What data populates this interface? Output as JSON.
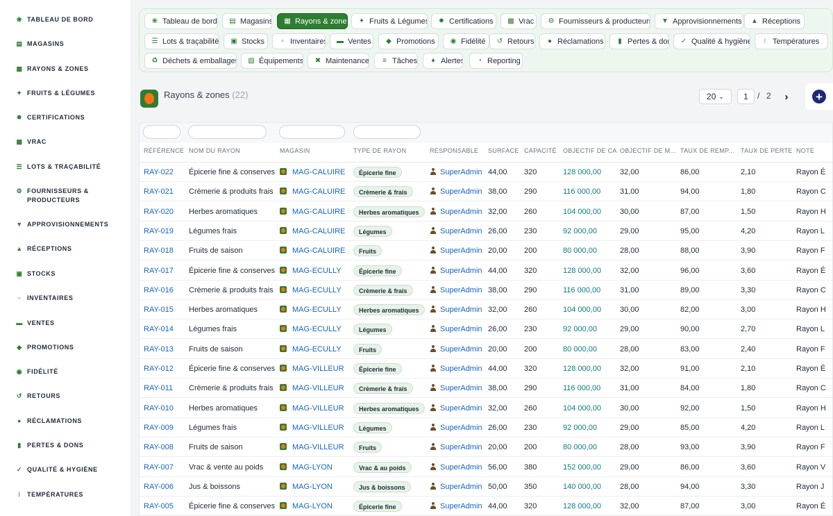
{
  "sidebar": {
    "items": [
      {
        "label": "TABLEAU DE BORD",
        "icon": "seedling-icon"
      },
      {
        "label": "MAGASINS",
        "icon": "store-icon"
      },
      {
        "label": "RAYONS & ZONES",
        "icon": "grid-icon"
      },
      {
        "label": "FRUITS & LÉGUMES",
        "icon": "carrot-icon"
      },
      {
        "label": "CERTIFICATIONS",
        "icon": "certificate-icon"
      },
      {
        "label": "VRAC",
        "icon": "boxes-icon"
      },
      {
        "label": "LOTS & TRAÇABILITÉ",
        "icon": "barcode-icon"
      },
      {
        "label": "FOURNISSEURS & PRODUCTEURS",
        "icon": "tractor-icon"
      },
      {
        "label": "APPROVISIONNEMENTS",
        "icon": "cart-icon"
      },
      {
        "label": "RÉCEPTIONS",
        "icon": "truck-icon"
      },
      {
        "label": "STOCKS",
        "icon": "warehouse-icon"
      },
      {
        "label": "INVENTAIRES",
        "icon": "clipboard-icon"
      },
      {
        "label": "VENTES",
        "icon": "cash-register-icon"
      },
      {
        "label": "PROMOTIONS",
        "icon": "tag-icon"
      },
      {
        "label": "FIDÉLITÉ",
        "icon": "award-icon"
      },
      {
        "label": "RETOURS",
        "icon": "undo-icon"
      },
      {
        "label": "RÉCLAMATIONS",
        "icon": "comment-icon"
      },
      {
        "label": "PERTES & DONS",
        "icon": "trash-icon"
      },
      {
        "label": "QUALITÉ & HYGIÈNE",
        "icon": "clipboard-check-icon"
      },
      {
        "label": "TEMPÉRATURES",
        "icon": "thermometer-icon"
      }
    ]
  },
  "nav": {
    "pills": [
      {
        "label": "Tableau de bord",
        "icon": "seedling-icon"
      },
      {
        "label": "Magasins",
        "icon": "store-icon"
      },
      {
        "label": "Rayons & zones",
        "icon": "grid-icon",
        "active": true
      },
      {
        "label": "Fruits & Légumes",
        "icon": "carrot-icon"
      },
      {
        "label": "Certifications",
        "icon": "certificate-icon"
      },
      {
        "label": "Vrac",
        "icon": "boxes-icon"
      },
      {
        "label": "Fournisseurs & producteurs",
        "icon": "tractor-icon"
      },
      {
        "label": "Approvisionnements",
        "icon": "cart-icon"
      },
      {
        "label": "Réceptions",
        "icon": "truck-icon"
      },
      {
        "label": "Lots & traçabilité",
        "icon": "barcode-icon"
      },
      {
        "label": "Stocks",
        "icon": "warehouse-icon"
      },
      {
        "label": "Inventaires",
        "icon": "clipboard-icon"
      },
      {
        "label": "Ventes",
        "icon": "cash-register-icon"
      },
      {
        "label": "Promotions",
        "icon": "tag-icon"
      },
      {
        "label": "Fidélité",
        "icon": "award-icon"
      },
      {
        "label": "Retours",
        "icon": "undo-icon"
      },
      {
        "label": "Réclamations",
        "icon": "comment-icon"
      },
      {
        "label": "Pertes & dons",
        "icon": "trash-icon"
      },
      {
        "label": "Qualité & hygiène",
        "icon": "clipboard-check-icon"
      },
      {
        "label": "Températures",
        "icon": "thermometer-icon"
      },
      {
        "label": "Déchets & emballages",
        "icon": "recycle-icon"
      },
      {
        "label": "Équipements",
        "icon": "toolbox-icon"
      },
      {
        "label": "Maintenance",
        "icon": "tools-icon"
      },
      {
        "label": "Tâches",
        "icon": "tasks-icon"
      },
      {
        "label": "Alertes",
        "icon": "bell-icon"
      },
      {
        "label": "Reporting",
        "icon": "chart-pie-icon"
      }
    ]
  },
  "page": {
    "title": "Rayons & zones",
    "count": "(22)"
  },
  "pagination": {
    "per_page": "20",
    "current": "1",
    "separator": "/",
    "total": "2"
  },
  "table": {
    "columns": [
      "RÉFÉRENCE",
      "NOM DU RAYON",
      "MAGASIN",
      "TYPE DE RAYON",
      "RESPONSABLE",
      "SURFACE",
      "CAPACITÉ",
      "OBJECTIF DE CA",
      "OBJECTIF DE M...",
      "TAUX DE REMP...",
      "TAUX DE PERTE",
      "NOTE"
    ],
    "rows": [
      {
        "ref": "RAY-022",
        "name": "Épicerie fine & conserves",
        "store": "MAG-CALUIRE",
        "type": "Épicerie fine",
        "resp": "SuperAdmin",
        "surface": "44,00",
        "capacity": "320",
        "ca": "128 000,00",
        "margin": "32,00",
        "fill": "86,00",
        "loss": "2,10",
        "note": "Rayon É"
      },
      {
        "ref": "RAY-021",
        "name": "Crèmerie & produits frais",
        "store": "MAG-CALUIRE",
        "type": "Crèmerie & frais",
        "resp": "SuperAdmin",
        "surface": "38,00",
        "capacity": "290",
        "ca": "116 000,00",
        "margin": "31,00",
        "fill": "94,00",
        "loss": "1,80",
        "note": "Rayon C"
      },
      {
        "ref": "RAY-020",
        "name": "Herbes aromatiques",
        "store": "MAG-CALUIRE",
        "type": "Herbes aromatiques",
        "resp": "SuperAdmin",
        "surface": "32,00",
        "capacity": "260",
        "ca": "104 000,00",
        "margin": "30,00",
        "fill": "87,00",
        "loss": "1,50",
        "note": "Rayon H"
      },
      {
        "ref": "RAY-019",
        "name": "Légumes frais",
        "store": "MAG-CALUIRE",
        "type": "Légumes",
        "resp": "SuperAdmin",
        "surface": "26,00",
        "capacity": "230",
        "ca": "92 000,00",
        "margin": "29,00",
        "fill": "95,00",
        "loss": "4,20",
        "note": "Rayon L"
      },
      {
        "ref": "RAY-018",
        "name": "Fruits de saison",
        "store": "MAG-CALUIRE",
        "type": "Fruits",
        "resp": "SuperAdmin",
        "surface": "20,00",
        "capacity": "200",
        "ca": "80 000,00",
        "margin": "28,00",
        "fill": "88,00",
        "loss": "3,90",
        "note": "Rayon F"
      },
      {
        "ref": "RAY-017",
        "name": "Épicerie fine & conserves",
        "store": "MAG-ECULLY",
        "type": "Épicerie fine",
        "resp": "SuperAdmin",
        "surface": "44,00",
        "capacity": "320",
        "ca": "128 000,00",
        "margin": "32,00",
        "fill": "96,00",
        "loss": "3,60",
        "note": "Rayon É"
      },
      {
        "ref": "RAY-016",
        "name": "Crèmerie & produits frais",
        "store": "MAG-ECULLY",
        "type": "Crèmerie & frais",
        "resp": "SuperAdmin",
        "surface": "38,00",
        "capacity": "290",
        "ca": "116 000,00",
        "margin": "31,00",
        "fill": "89,00",
        "loss": "3,30",
        "note": "Rayon C"
      },
      {
        "ref": "RAY-015",
        "name": "Herbes aromatiques",
        "store": "MAG-ECULLY",
        "type": "Herbes aromatiques",
        "resp": "SuperAdmin",
        "surface": "32,00",
        "capacity": "260",
        "ca": "104 000,00",
        "margin": "30,00",
        "fill": "82,00",
        "loss": "3,00",
        "note": "Rayon H"
      },
      {
        "ref": "RAY-014",
        "name": "Légumes frais",
        "store": "MAG-ECULLY",
        "type": "Légumes",
        "resp": "SuperAdmin",
        "surface": "26,00",
        "capacity": "230",
        "ca": "92 000,00",
        "margin": "29,00",
        "fill": "90,00",
        "loss": "2,70",
        "note": "Rayon L"
      },
      {
        "ref": "RAY-013",
        "name": "Fruits de saison",
        "store": "MAG-ECULLY",
        "type": "Fruits",
        "resp": "SuperAdmin",
        "surface": "20,00",
        "capacity": "200",
        "ca": "80 000,00",
        "margin": "28,00",
        "fill": "83,00",
        "loss": "2,40",
        "note": "Rayon F"
      },
      {
        "ref": "RAY-012",
        "name": "Épicerie fine & conserves",
        "store": "MAG-VILLEUR",
        "type": "Épicerie fine",
        "resp": "SuperAdmin",
        "surface": "44,00",
        "capacity": "320",
        "ca": "128 000,00",
        "margin": "32,00",
        "fill": "91,00",
        "loss": "2,10",
        "note": "Rayon É"
      },
      {
        "ref": "RAY-011",
        "name": "Crèmerie & produits frais",
        "store": "MAG-VILLEUR",
        "type": "Crèmerie & frais",
        "resp": "SuperAdmin",
        "surface": "38,00",
        "capacity": "290",
        "ca": "116 000,00",
        "margin": "31,00",
        "fill": "84,00",
        "loss": "1,80",
        "note": "Rayon C"
      },
      {
        "ref": "RAY-010",
        "name": "Herbes aromatiques",
        "store": "MAG-VILLEUR",
        "type": "Herbes aromatiques",
        "resp": "SuperAdmin",
        "surface": "32,00",
        "capacity": "260",
        "ca": "104 000,00",
        "margin": "30,00",
        "fill": "92,00",
        "loss": "1,50",
        "note": "Rayon H"
      },
      {
        "ref": "RAY-009",
        "name": "Légumes frais",
        "store": "MAG-VILLEUR",
        "type": "Légumes",
        "resp": "SuperAdmin",
        "surface": "26,00",
        "capacity": "230",
        "ca": "92 000,00",
        "margin": "29,00",
        "fill": "85,00",
        "loss": "4,20",
        "note": "Rayon L"
      },
      {
        "ref": "RAY-008",
        "name": "Fruits de saison",
        "store": "MAG-VILLEUR",
        "type": "Fruits",
        "resp": "SuperAdmin",
        "surface": "20,00",
        "capacity": "200",
        "ca": "80 000,00",
        "margin": "28,00",
        "fill": "93,00",
        "loss": "3,90",
        "note": "Rayon F"
      },
      {
        "ref": "RAY-007",
        "name": "Vrac & vente au poids",
        "store": "MAG-LYON",
        "type": "Vrac & au poids",
        "resp": "SuperAdmin",
        "surface": "56,00",
        "capacity": "380",
        "ca": "152 000,00",
        "margin": "29,00",
        "fill": "86,00",
        "loss": "3,60",
        "note": "Rayon V"
      },
      {
        "ref": "RAY-006",
        "name": "Jus & boissons",
        "store": "MAG-LYON",
        "type": "Jus & boissons",
        "resp": "SuperAdmin",
        "surface": "50,00",
        "capacity": "350",
        "ca": "140 000,00",
        "margin": "28,00",
        "fill": "94,00",
        "loss": "3,30",
        "note": "Rayon J"
      },
      {
        "ref": "RAY-005",
        "name": "Épicerie fine & conserves",
        "store": "MAG-LYON",
        "type": "Épicerie fine",
        "resp": "SuperAdmin",
        "surface": "44,00",
        "capacity": "320",
        "ca": "128 000,00",
        "margin": "32,00",
        "fill": "87,00",
        "loss": "3,00",
        "note": "Rayon É"
      }
    ]
  },
  "colors": {
    "brand": "#2e7d32",
    "link": "#1565c0",
    "money": "#0e7a83",
    "add_button": "#1e2a78"
  }
}
